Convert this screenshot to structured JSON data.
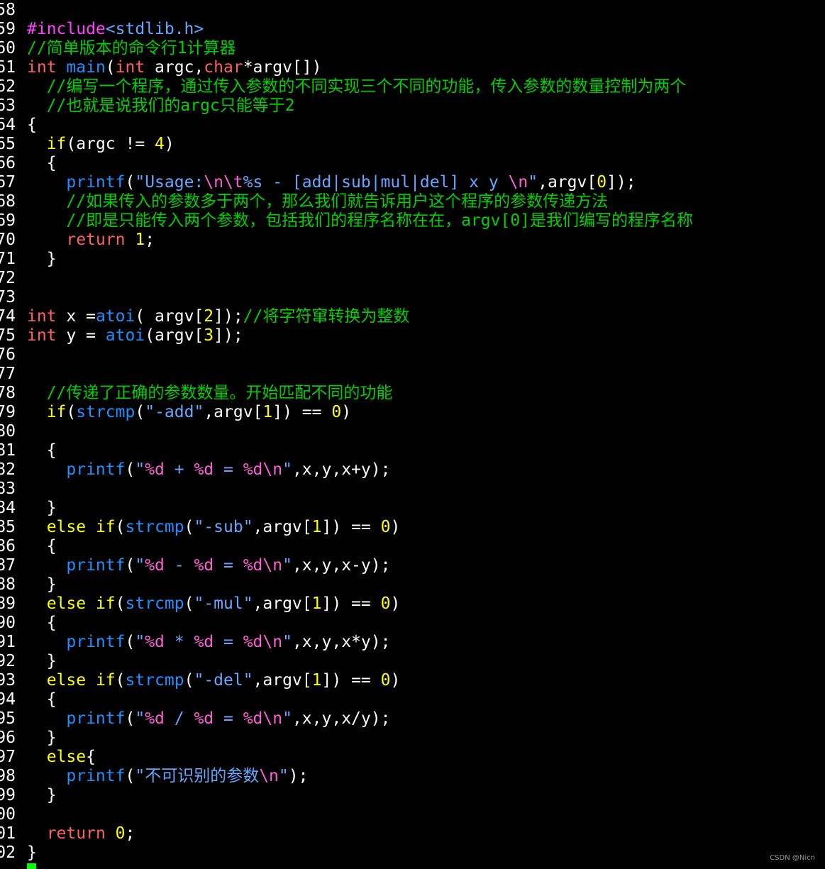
{
  "editor": {
    "lines": [
      {
        "num": "58",
        "tokens": []
      },
      {
        "num": "59",
        "tokens": [
          {
            "t": "#include",
            "c": "pp"
          },
          {
            "t": "<stdlib.h>",
            "c": "str"
          }
        ]
      },
      {
        "num": "60",
        "tokens": [
          {
            "t": "//简单版本的命令行1计算器",
            "c": "cm"
          }
        ]
      },
      {
        "num": "61",
        "tokens": [
          {
            "t": "int",
            "c": "type"
          },
          {
            "t": " ",
            "c": "plain"
          },
          {
            "t": "main",
            "c": "fn"
          },
          {
            "t": "(",
            "c": "plain"
          },
          {
            "t": "int",
            "c": "type"
          },
          {
            "t": " argc,",
            "c": "plain"
          },
          {
            "t": "char",
            "c": "type"
          },
          {
            "t": "*argv[])",
            "c": "plain"
          }
        ]
      },
      {
        "num": "62",
        "tokens": [
          {
            "t": "  //编写一个程序，通过传入参数的不同实现三个不同的功能，传入参数的数量控制为两个",
            "c": "cm"
          }
        ]
      },
      {
        "num": "63",
        "tokens": [
          {
            "t": "  //也就是说我们的argc只能等于2",
            "c": "cm"
          }
        ]
      },
      {
        "num": "64",
        "tokens": [
          {
            "t": "{",
            "c": "plain"
          }
        ]
      },
      {
        "num": "65",
        "tokens": [
          {
            "t": "  ",
            "c": "plain"
          },
          {
            "t": "if",
            "c": "kw"
          },
          {
            "t": "(argc != ",
            "c": "plain"
          },
          {
            "t": "4",
            "c": "num"
          },
          {
            "t": ")",
            "c": "plain"
          }
        ]
      },
      {
        "num": "66",
        "tokens": [
          {
            "t": "  {",
            "c": "plain"
          }
        ]
      },
      {
        "num": "67",
        "tokens": [
          {
            "t": "    ",
            "c": "plain"
          },
          {
            "t": "printf",
            "c": "fn"
          },
          {
            "t": "(",
            "c": "plain"
          },
          {
            "t": "\"Usage:",
            "c": "str"
          },
          {
            "t": "\\n\\t",
            "c": "esc"
          },
          {
            "t": "%s - [add|sub|mul|del] x y ",
            "c": "str"
          },
          {
            "t": "\\n",
            "c": "esc"
          },
          {
            "t": "\"",
            "c": "str"
          },
          {
            "t": ",argv[",
            "c": "plain"
          },
          {
            "t": "0",
            "c": "num"
          },
          {
            "t": "]);",
            "c": "plain"
          }
        ]
      },
      {
        "num": "68",
        "tokens": [
          {
            "t": "    //如果传入的参数多于两个，那么我们就告诉用户这个程序的参数传递方法",
            "c": "cm"
          }
        ]
      },
      {
        "num": "69",
        "tokens": [
          {
            "t": "    //即是只能传入两个参数，包括我们的程序名称在在，argv[0]是我们编写的程序名称",
            "c": "cm"
          }
        ]
      },
      {
        "num": "70",
        "tokens": [
          {
            "t": "    ",
            "c": "plain"
          },
          {
            "t": "return",
            "c": "type"
          },
          {
            "t": " ",
            "c": "plain"
          },
          {
            "t": "1",
            "c": "num"
          },
          {
            "t": ";",
            "c": "plain"
          }
        ]
      },
      {
        "num": "71",
        "tokens": [
          {
            "t": "  }",
            "c": "plain"
          }
        ]
      },
      {
        "num": "72",
        "tokens": []
      },
      {
        "num": "73",
        "tokens": []
      },
      {
        "num": "74",
        "tokens": [
          {
            "t": "int",
            "c": "type"
          },
          {
            "t": " x =",
            "c": "plain"
          },
          {
            "t": "atoi",
            "c": "fn"
          },
          {
            "t": "( argv[",
            "c": "plain"
          },
          {
            "t": "2",
            "c": "num"
          },
          {
            "t": "]);",
            "c": "plain"
          },
          {
            "t": "//将字符窜转换为整数",
            "c": "cm"
          }
        ]
      },
      {
        "num": "75",
        "tokens": [
          {
            "t": "int",
            "c": "type"
          },
          {
            "t": " y = ",
            "c": "plain"
          },
          {
            "t": "atoi",
            "c": "fn"
          },
          {
            "t": "(argv[",
            "c": "plain"
          },
          {
            "t": "3",
            "c": "num"
          },
          {
            "t": "]);",
            "c": "plain"
          }
        ]
      },
      {
        "num": "76",
        "tokens": []
      },
      {
        "num": "77",
        "tokens": []
      },
      {
        "num": "78",
        "tokens": [
          {
            "t": "  //传递了正确的参数数量。开始匹配不同的功能",
            "c": "cm"
          }
        ]
      },
      {
        "num": "79",
        "tokens": [
          {
            "t": "  ",
            "c": "plain"
          },
          {
            "t": "if",
            "c": "kw"
          },
          {
            "t": "(",
            "c": "plain"
          },
          {
            "t": "strcmp",
            "c": "fn"
          },
          {
            "t": "(",
            "c": "plain"
          },
          {
            "t": "\"-add\"",
            "c": "str"
          },
          {
            "t": ",argv[",
            "c": "plain"
          },
          {
            "t": "1",
            "c": "num"
          },
          {
            "t": "]) == ",
            "c": "plain"
          },
          {
            "t": "0",
            "c": "num"
          },
          {
            "t": ")",
            "c": "plain"
          }
        ]
      },
      {
        "num": "80",
        "tokens": []
      },
      {
        "num": "81",
        "tokens": [
          {
            "t": "  {",
            "c": "plain"
          }
        ]
      },
      {
        "num": "82",
        "tokens": [
          {
            "t": "    ",
            "c": "plain"
          },
          {
            "t": "printf",
            "c": "fn"
          },
          {
            "t": "(",
            "c": "plain"
          },
          {
            "t": "\"",
            "c": "str"
          },
          {
            "t": "%d",
            "c": "esc"
          },
          {
            "t": " + ",
            "c": "str"
          },
          {
            "t": "%d",
            "c": "esc"
          },
          {
            "t": " = ",
            "c": "str"
          },
          {
            "t": "%d\\n",
            "c": "esc"
          },
          {
            "t": "\"",
            "c": "str"
          },
          {
            "t": ",x,y,x+y);",
            "c": "plain"
          }
        ]
      },
      {
        "num": "83",
        "tokens": []
      },
      {
        "num": "84",
        "tokens": [
          {
            "t": "  }",
            "c": "plain"
          }
        ]
      },
      {
        "num": "85",
        "tokens": [
          {
            "t": "  ",
            "c": "plain"
          },
          {
            "t": "else if",
            "c": "kw"
          },
          {
            "t": "(",
            "c": "plain"
          },
          {
            "t": "strcmp",
            "c": "fn"
          },
          {
            "t": "(",
            "c": "plain"
          },
          {
            "t": "\"-sub\"",
            "c": "str"
          },
          {
            "t": ",argv[",
            "c": "plain"
          },
          {
            "t": "1",
            "c": "num"
          },
          {
            "t": "]) == ",
            "c": "plain"
          },
          {
            "t": "0",
            "c": "num"
          },
          {
            "t": ")",
            "c": "plain"
          }
        ]
      },
      {
        "num": "86",
        "tokens": [
          {
            "t": "  {",
            "c": "plain"
          }
        ]
      },
      {
        "num": "87",
        "tokens": [
          {
            "t": "    ",
            "c": "plain"
          },
          {
            "t": "printf",
            "c": "fn"
          },
          {
            "t": "(",
            "c": "plain"
          },
          {
            "t": "\"",
            "c": "str"
          },
          {
            "t": "%d",
            "c": "esc"
          },
          {
            "t": " - ",
            "c": "str"
          },
          {
            "t": "%d",
            "c": "esc"
          },
          {
            "t": " = ",
            "c": "str"
          },
          {
            "t": "%d\\n",
            "c": "esc"
          },
          {
            "t": "\"",
            "c": "str"
          },
          {
            "t": ",x,y,x-y);",
            "c": "plain"
          }
        ]
      },
      {
        "num": "88",
        "tokens": [
          {
            "t": "  }",
            "c": "plain"
          }
        ]
      },
      {
        "num": "89",
        "tokens": [
          {
            "t": "  ",
            "c": "plain"
          },
          {
            "t": "else if",
            "c": "kw"
          },
          {
            "t": "(",
            "c": "plain"
          },
          {
            "t": "strcmp",
            "c": "fn"
          },
          {
            "t": "(",
            "c": "plain"
          },
          {
            "t": "\"-mul\"",
            "c": "str"
          },
          {
            "t": ",argv[",
            "c": "plain"
          },
          {
            "t": "1",
            "c": "num"
          },
          {
            "t": "]) == ",
            "c": "plain"
          },
          {
            "t": "0",
            "c": "num"
          },
          {
            "t": ")",
            "c": "plain"
          }
        ]
      },
      {
        "num": "90",
        "tokens": [
          {
            "t": "  {",
            "c": "plain"
          }
        ]
      },
      {
        "num": "91",
        "tokens": [
          {
            "t": "    ",
            "c": "plain"
          },
          {
            "t": "printf",
            "c": "fn"
          },
          {
            "t": "(",
            "c": "plain"
          },
          {
            "t": "\"",
            "c": "str"
          },
          {
            "t": "%d",
            "c": "esc"
          },
          {
            "t": " * ",
            "c": "str"
          },
          {
            "t": "%d",
            "c": "esc"
          },
          {
            "t": " = ",
            "c": "str"
          },
          {
            "t": "%d\\n",
            "c": "esc"
          },
          {
            "t": "\"",
            "c": "str"
          },
          {
            "t": ",x,y,x*y);",
            "c": "plain"
          }
        ]
      },
      {
        "num": "92",
        "tokens": [
          {
            "t": "  }",
            "c": "plain"
          }
        ]
      },
      {
        "num": "93",
        "tokens": [
          {
            "t": "  ",
            "c": "plain"
          },
          {
            "t": "else if",
            "c": "kw"
          },
          {
            "t": "(",
            "c": "plain"
          },
          {
            "t": "strcmp",
            "c": "fn"
          },
          {
            "t": "(",
            "c": "plain"
          },
          {
            "t": "\"-del\"",
            "c": "str"
          },
          {
            "t": ",argv[",
            "c": "plain"
          },
          {
            "t": "1",
            "c": "num"
          },
          {
            "t": "]) == ",
            "c": "plain"
          },
          {
            "t": "0",
            "c": "num"
          },
          {
            "t": ")",
            "c": "plain"
          }
        ]
      },
      {
        "num": "94",
        "tokens": [
          {
            "t": "  {",
            "c": "plain"
          }
        ]
      },
      {
        "num": "95",
        "tokens": [
          {
            "t": "    ",
            "c": "plain"
          },
          {
            "t": "printf",
            "c": "fn"
          },
          {
            "t": "(",
            "c": "plain"
          },
          {
            "t": "\"",
            "c": "str"
          },
          {
            "t": "%d",
            "c": "esc"
          },
          {
            "t": " / ",
            "c": "str"
          },
          {
            "t": "%d",
            "c": "esc"
          },
          {
            "t": " = ",
            "c": "str"
          },
          {
            "t": "%d\\n",
            "c": "esc"
          },
          {
            "t": "\"",
            "c": "str"
          },
          {
            "t": ",x,y,x/y);",
            "c": "plain"
          }
        ]
      },
      {
        "num": "96",
        "tokens": [
          {
            "t": "  }",
            "c": "plain"
          }
        ]
      },
      {
        "num": "97",
        "tokens": [
          {
            "t": "  ",
            "c": "plain"
          },
          {
            "t": "else",
            "c": "kw"
          },
          {
            "t": "{",
            "c": "plain"
          }
        ]
      },
      {
        "num": "98",
        "tokens": [
          {
            "t": "    ",
            "c": "plain"
          },
          {
            "t": "printf",
            "c": "fn"
          },
          {
            "t": "(",
            "c": "plain"
          },
          {
            "t": "\"不可识别的参数",
            "c": "str"
          },
          {
            "t": "\\n",
            "c": "esc"
          },
          {
            "t": "\"",
            "c": "str"
          },
          {
            "t": ");",
            "c": "plain"
          }
        ]
      },
      {
        "num": "99",
        "tokens": [
          {
            "t": "  }",
            "c": "plain"
          }
        ]
      },
      {
        "num": "00",
        "tokens": []
      },
      {
        "num": "01",
        "tokens": [
          {
            "t": "  ",
            "c": "plain"
          },
          {
            "t": "return",
            "c": "type"
          },
          {
            "t": " ",
            "c": "plain"
          },
          {
            "t": "0",
            "c": "num"
          },
          {
            "t": ";",
            "c": "plain"
          }
        ]
      },
      {
        "num": "02",
        "tokens": [
          {
            "t": "}",
            "c": "plain"
          }
        ]
      }
    ]
  },
  "watermark": "CSDN @Nicn",
  "colors": {
    "background": "#000000",
    "keyword": "#ffff00",
    "type": "#ff6060",
    "function": "#1e90ff",
    "string": "#66a8ff",
    "escape": "#ff5fd7",
    "number": "#ffff00",
    "comment": "#00d000",
    "preprocessor": "#ff40ff",
    "cursor": "#00ff00"
  }
}
